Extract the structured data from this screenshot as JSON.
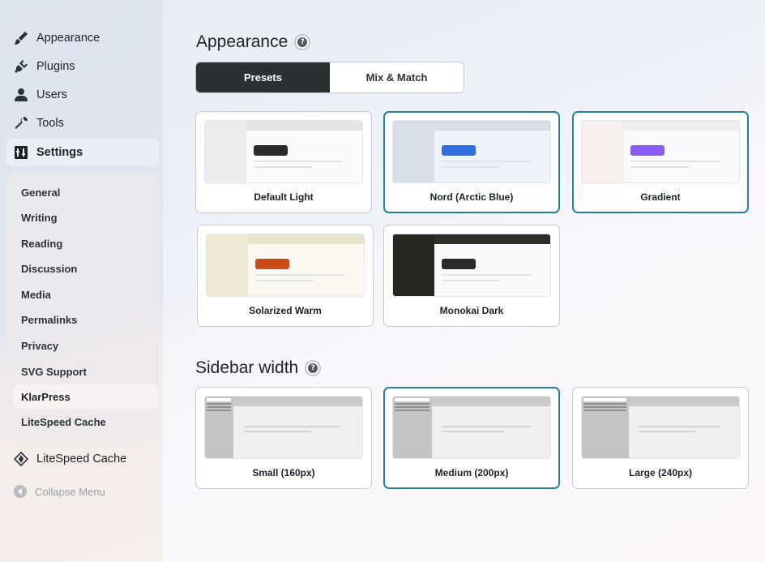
{
  "sidebar": {
    "top_items": [
      {
        "label": "Appearance",
        "icon": "paintbrush-icon"
      },
      {
        "label": "Plugins",
        "icon": "plug-icon"
      },
      {
        "label": "Users",
        "icon": "user-icon"
      },
      {
        "label": "Tools",
        "icon": "wrench-icon"
      },
      {
        "label": "Settings",
        "icon": "settings-icon"
      }
    ],
    "submenu": [
      "General",
      "Writing",
      "Reading",
      "Discussion",
      "Media",
      "Permalinks",
      "Privacy",
      "SVG Support",
      "KlarPress",
      "LiteSpeed Cache"
    ],
    "current_submenu": "KlarPress",
    "extra_item": {
      "label": "LiteSpeed Cache",
      "icon": "litespeed-diamond-icon"
    },
    "collapse_label": "Collapse Menu"
  },
  "appearance": {
    "title": "Appearance",
    "help": "?",
    "tabs": [
      {
        "label": "Presets",
        "active": true
      },
      {
        "label": "Mix & Match",
        "active": false
      }
    ],
    "presets": [
      {
        "label": "Default Light",
        "selected": false,
        "side": "#ececec",
        "top": "#e4e4e4",
        "main": "#fafafa",
        "button": "#2b2b2b"
      },
      {
        "label": "Nord (Arctic Blue)",
        "selected": true,
        "side": "#d8dee9",
        "top": "#d8dee9",
        "main": "#eef2fa",
        "button": "#2f6fe0"
      },
      {
        "label": "Gradient",
        "selected": true,
        "side": "#f6efec",
        "top": "#f1ecec",
        "main": "#faf9fb",
        "button": "#8b5cf6"
      },
      {
        "label": "Solarized Warm",
        "selected": false,
        "side": "#eee8d5",
        "top": "#e8e2cf",
        "main": "#fbf8f1",
        "button": "#cb4b16"
      },
      {
        "label": "Monokai Dark",
        "selected": false,
        "side": "#272822",
        "top": "#2d2d2a",
        "main": "#fafafa",
        "button": "#2b2b2b"
      }
    ]
  },
  "sidebar_width": {
    "title": "Sidebar width",
    "help": "?",
    "options": [
      {
        "label": "Small (160px)",
        "selected": false
      },
      {
        "label": "Medium (200px)",
        "selected": true
      },
      {
        "label": "Large (240px)",
        "selected": false
      }
    ]
  },
  "colors": {
    "accent": "#2a7fa4",
    "dark": "#2b3033"
  }
}
